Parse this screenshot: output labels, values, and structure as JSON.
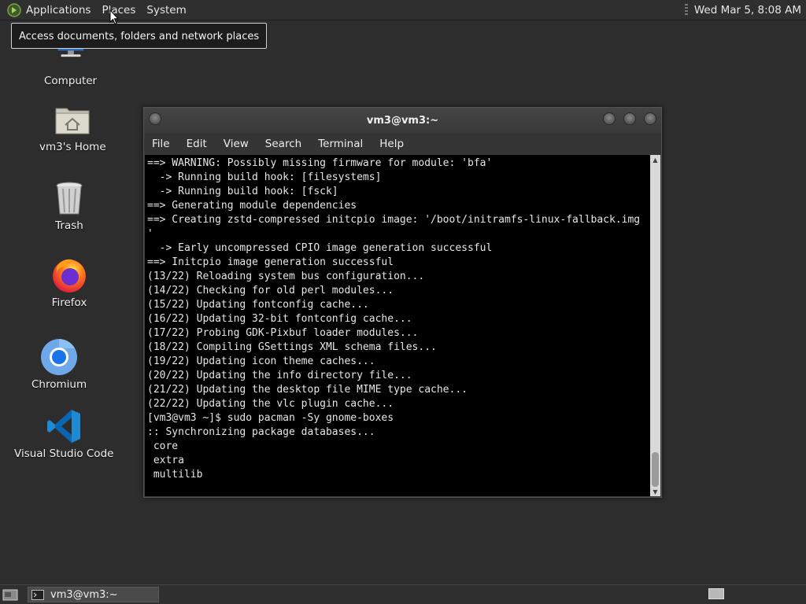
{
  "top_panel": {
    "menus": [
      "Applications",
      "Places",
      "System"
    ],
    "clock": "Wed Mar  5,  8:08 AM"
  },
  "tooltip": "Access documents, folders and network places",
  "desktop": {
    "icons": [
      {
        "label": "Computer",
        "icon": "computer-icon"
      },
      {
        "label": "vm3's Home",
        "icon": "home-folder-icon"
      },
      {
        "label": "Trash",
        "icon": "trash-icon"
      },
      {
        "label": "Firefox",
        "icon": "firefox-icon"
      },
      {
        "label": "Chromium",
        "icon": "chromium-icon"
      },
      {
        "label": "Visual Studio Code",
        "icon": "vscode-icon"
      }
    ]
  },
  "terminal": {
    "title": "vm3@vm3:~",
    "menu": [
      "File",
      "Edit",
      "View",
      "Search",
      "Terminal",
      "Help"
    ],
    "lines": [
      "==> WARNING: Possibly missing firmware for module: 'bfa'",
      "  -> Running build hook: [filesystems]",
      "  -> Running build hook: [fsck]",
      "==> Generating module dependencies",
      "==> Creating zstd-compressed initcpio image: '/boot/initramfs-linux-fallback.img",
      "'",
      "  -> Early uncompressed CPIO image generation successful",
      "==> Initcpio image generation successful",
      "(13/22) Reloading system bus configuration...",
      "(14/22) Checking for old perl modules...",
      "(15/22) Updating fontconfig cache...",
      "(16/22) Updating 32-bit fontconfig cache...",
      "(17/22) Probing GDK-Pixbuf loader modules...",
      "(18/22) Compiling GSettings XML schema files...",
      "(19/22) Updating icon theme caches...",
      "(20/22) Updating the info directory file...",
      "(21/22) Updating the desktop file MIME type cache...",
      "(22/22) Updating the vlc plugin cache...",
      "[vm3@vm3 ~]$ sudo pacman -Sy gnome-boxes",
      ":: Synchronizing package databases...",
      " core",
      " extra",
      " multilib"
    ]
  },
  "taskbar": {
    "task_label": "vm3@vm3:~"
  }
}
